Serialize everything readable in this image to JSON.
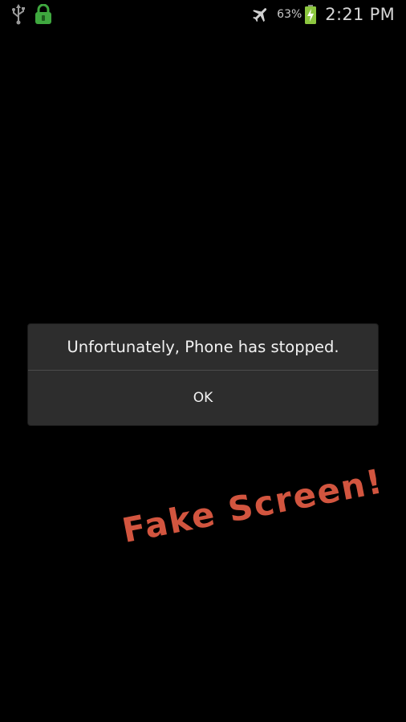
{
  "status_bar": {
    "left_icons": [
      "usb-icon",
      "lock-icon"
    ],
    "right_icons": [
      "airplane-mode-icon",
      "battery-charging-icon"
    ],
    "battery_percent": "63%",
    "time": "2:21 PM",
    "colors": {
      "lock": "#3fa83f",
      "battery_fill": "#8cc63f"
    }
  },
  "dialog": {
    "message": "Unfortunately, Phone has stopped.",
    "ok_label": "OK"
  },
  "watermark": {
    "text": "Fake Screen!",
    "color": "#d2553f"
  }
}
